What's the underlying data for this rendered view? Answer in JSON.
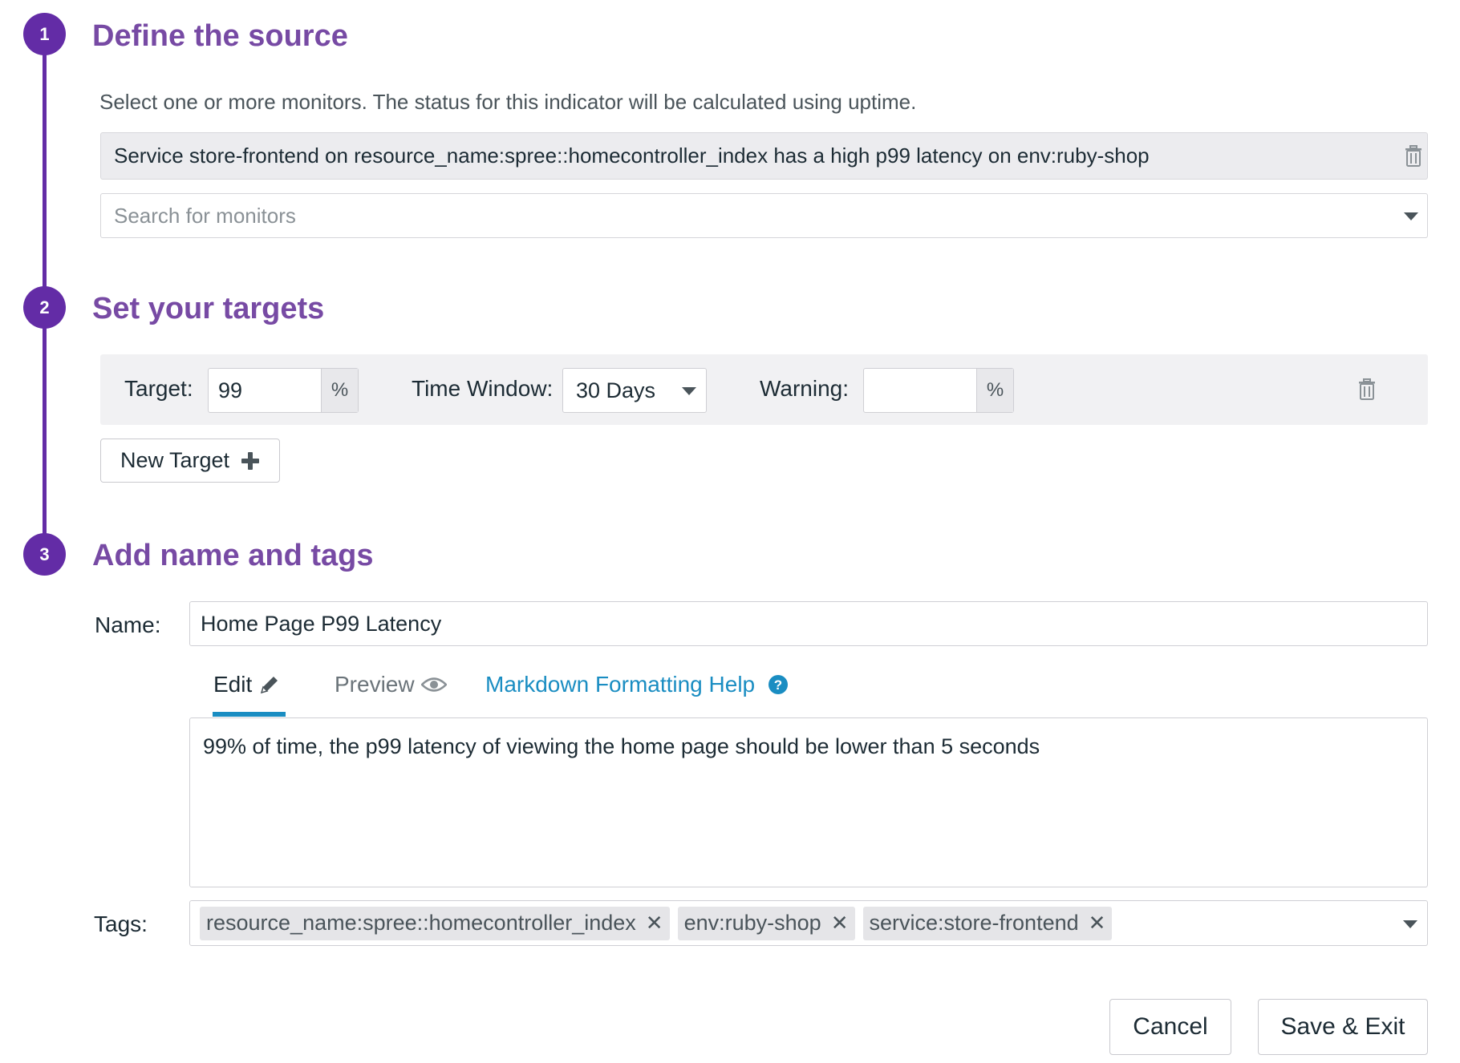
{
  "steps": [
    {
      "number": "1",
      "title": "Define the source"
    },
    {
      "number": "2",
      "title": "Set your targets"
    },
    {
      "number": "3",
      "title": "Add name and tags"
    }
  ],
  "source": {
    "description": "Select one or more monitors. The status for this indicator will be calculated using uptime.",
    "selected_monitor": "Service store-frontend on resource_name:spree::homecontroller_index has a high p99 latency on env:ruby-shop",
    "search_placeholder": "Search for monitors"
  },
  "targets": {
    "target_label": "Target:",
    "target_value": "99",
    "percent_unit": "%",
    "time_window_label": "Time Window:",
    "time_window_value": "30 Days",
    "warning_label": "Warning:",
    "warning_value": "",
    "new_target_label": "New Target"
  },
  "naming": {
    "name_label": "Name:",
    "name_value": "Home Page P99 Latency",
    "tabs": {
      "edit": "Edit",
      "preview": "Preview",
      "help": "Markdown Formatting Help"
    },
    "description_text": "99% of time, the p99 latency of viewing the home page should be lower than 5 seconds",
    "tags_label": "Tags:",
    "tags": [
      "resource_name:spree::homecontroller_index",
      "env:ruby-shop",
      "service:store-frontend"
    ]
  },
  "actions": {
    "cancel": "Cancel",
    "save": "Save & Exit"
  },
  "colors": {
    "step_accent": "#632ca6",
    "title_purple": "#774aa4",
    "link_blue": "#1a8dc2"
  },
  "icons": [
    "trash-icon",
    "caret-down-icon",
    "plus-icon",
    "pencil-icon",
    "eye-icon",
    "help-circle-icon",
    "close-icon"
  ]
}
